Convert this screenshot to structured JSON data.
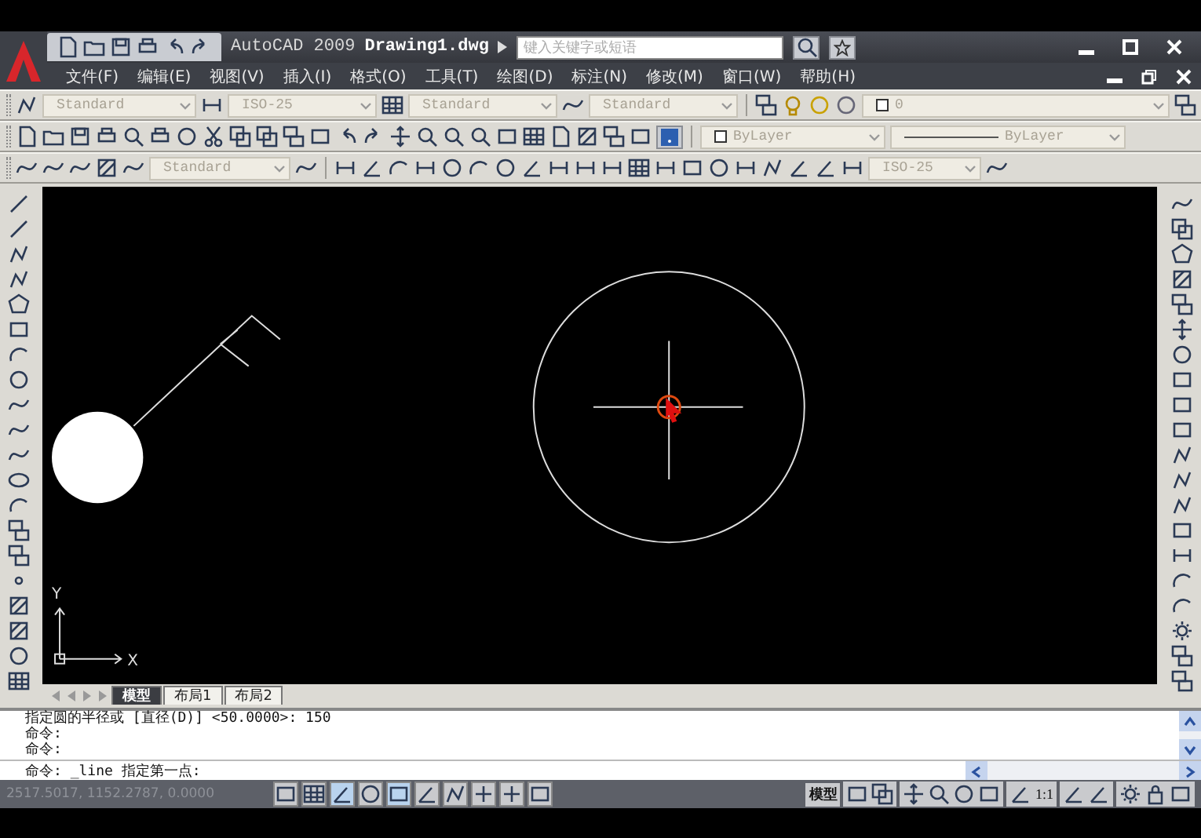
{
  "window": {
    "title": "AutoCAD 2009",
    "document": "Drawing1.dwg",
    "search_placeholder": "键入关键字或短语"
  },
  "menu": [
    "文件(F)",
    "编辑(E)",
    "视图(V)",
    "插入(I)",
    "格式(O)",
    "工具(T)",
    "绘图(D)",
    "标注(N)",
    "修改(M)",
    "窗口(W)",
    "帮助(H)"
  ],
  "toolbars": {
    "text_style": "Standard",
    "dim_style": "ISO-25",
    "table_style": "Standard",
    "multileader_style": "Standard",
    "layer": "0",
    "color_control": "ByLayer",
    "linetype": "ByLayer",
    "style_row3": "Standard",
    "dim_style_row3": "ISO-25"
  },
  "ucs": {
    "x_label": "X",
    "y_label": "Y"
  },
  "layout_tabs": [
    {
      "label": "模型",
      "selected": true
    },
    {
      "label": "布局1",
      "selected": false
    },
    {
      "label": "布局2",
      "selected": false
    }
  ],
  "command_history": [
    "指定圆的半径或 [直径(D)] <50.0000>: 150",
    "命令:",
    "命令:"
  ],
  "command_line": "命令: _line 指定第一点:",
  "status_bar": {
    "coordinates": "2517.5017, 1152.2787, 0.0000",
    "toggles": [
      {
        "on": false
      },
      {
        "on": false
      },
      {
        "on": true
      },
      {
        "on": false
      },
      {
        "on": true
      },
      {
        "on": false
      },
      {
        "on": false
      },
      {
        "on": false
      },
      {
        "on": false
      },
      {
        "on": false
      }
    ],
    "space_label": "模型",
    "scale": "1:1"
  }
}
